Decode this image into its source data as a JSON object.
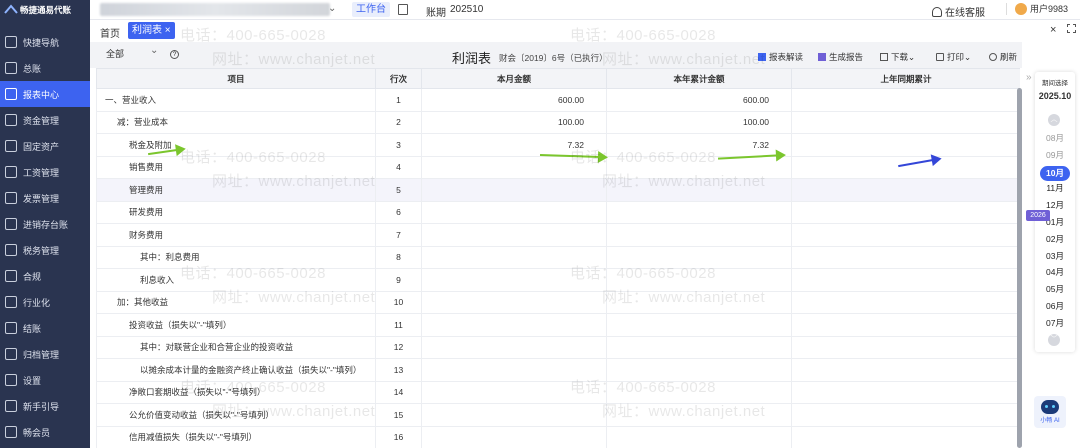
{
  "brand": "畅捷通易代账",
  "nav": [
    "快捷导航",
    "总账",
    "报表中心",
    "资金管理",
    "固定资产",
    "工资管理",
    "发票管理",
    "进销存台账",
    "税务管理",
    "合规",
    "行业化",
    "结账",
    "归档管理",
    "设置",
    "新手引导",
    "畅会员"
  ],
  "nav_active_index": 2,
  "topbar": {
    "workbench": "工作台",
    "period_label": "账期",
    "period_value": "202510",
    "support": "在线客服",
    "user": "用户9983"
  },
  "tabs": {
    "home": "首页",
    "report": "利润表 ×",
    "close": "×"
  },
  "toolbar": {
    "filter": "全部",
    "help": "?",
    "title": "利润表",
    "standard": "财会〔2019〕6号（已执行）",
    "ai_interpret": "报表解读",
    "ai_report": "生成报告",
    "download": "下载",
    "print": "打印",
    "refresh": "刷新"
  },
  "table": {
    "headers": [
      "项目",
      "行次",
      "本月金额",
      "本年累计金额",
      "上年同期累计"
    ],
    "rows": [
      {
        "name": "一、营业收入",
        "line": "1",
        "month": "600.00",
        "ytd": "600.00",
        "prev": "",
        "indent": 0
      },
      {
        "name": "减：营业成本",
        "line": "2",
        "month": "100.00",
        "ytd": "100.00",
        "prev": "",
        "indent": 1
      },
      {
        "name": "税金及附加",
        "line": "3",
        "month": "7.32",
        "ytd": "7.32",
        "prev": "",
        "indent": 2
      },
      {
        "name": "销售费用",
        "line": "4",
        "month": "",
        "ytd": "",
        "prev": "",
        "indent": 2
      },
      {
        "name": "管理费用",
        "line": "5",
        "month": "",
        "ytd": "",
        "prev": "",
        "indent": 2
      },
      {
        "name": "研发费用",
        "line": "6",
        "month": "",
        "ytd": "",
        "prev": "",
        "indent": 2
      },
      {
        "name": "财务费用",
        "line": "7",
        "month": "",
        "ytd": "",
        "prev": "",
        "indent": 2
      },
      {
        "name": "其中：利息费用",
        "line": "8",
        "month": "",
        "ytd": "",
        "prev": "",
        "indent": 3
      },
      {
        "name": "利息收入",
        "line": "9",
        "month": "",
        "ytd": "",
        "prev": "",
        "indent": 4
      },
      {
        "name": "加：其他收益",
        "line": "10",
        "month": "",
        "ytd": "",
        "prev": "",
        "indent": 1
      },
      {
        "name": "投资收益（损失以\"-\"填列）",
        "line": "11",
        "month": "",
        "ytd": "",
        "prev": "",
        "indent": 2
      },
      {
        "name": "其中：对联营企业和合营企业的投资收益",
        "line": "12",
        "month": "",
        "ytd": "",
        "prev": "",
        "indent": 3
      },
      {
        "name": "以摊余成本计量的金融资产终止确认收益（损失以\"-\"填列）",
        "line": "13",
        "month": "",
        "ytd": "",
        "prev": "",
        "indent": 4
      },
      {
        "name": "净敞口套期收益（损失以\"-\"号填列）",
        "line": "14",
        "month": "",
        "ytd": "",
        "prev": "",
        "indent": 2
      },
      {
        "name": "公允价值变动收益（损失以\"-\"号填列）",
        "line": "15",
        "month": "",
        "ytd": "",
        "prev": "",
        "indent": 2
      },
      {
        "name": "信用减值损失（损失以\"-\"号填列）",
        "line": "16",
        "month": "",
        "ytd": "",
        "prev": "",
        "indent": 2
      }
    ]
  },
  "period_panel": {
    "title": "期间选择",
    "current": "2025.10",
    "year_badge": "2026",
    "months": [
      "08月",
      "09月",
      "10月",
      "11月",
      "12月",
      "01月",
      "02月",
      "03月",
      "04月",
      "05月",
      "06月",
      "07月"
    ],
    "selected": "10月"
  },
  "watermark": {
    "phone": "电话：400-665-0028",
    "site": "网址：www.chanjet.net"
  },
  "ai_assistant": "小畅 AI"
}
